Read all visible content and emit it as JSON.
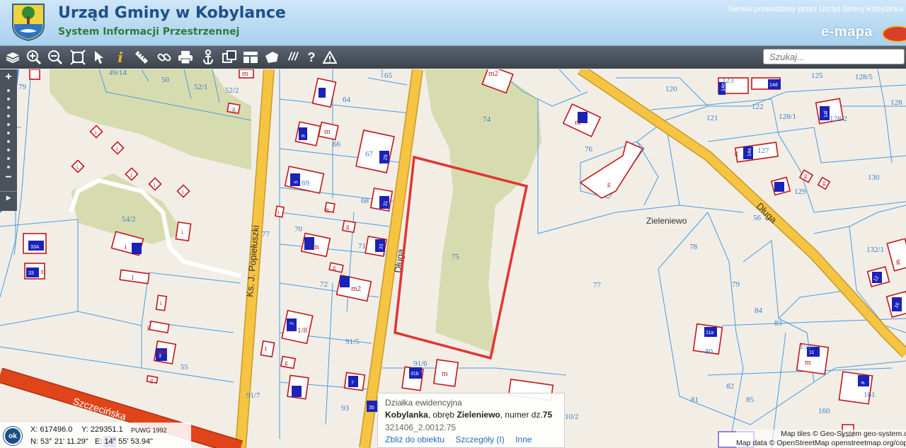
{
  "header": {
    "title": "Urząd Gminy w Kobylance",
    "subtitle": "System Informacji Przestrzennej",
    "service": "Serwis prowadzony przez Urząd Gminy Kobylanka",
    "brand": "e-mapa"
  },
  "toolbar": {
    "tools": [
      "layers-icon",
      "zoom-in-icon",
      "zoom-out-icon",
      "zoom-extent-icon",
      "pointer-icon",
      "info-icon",
      "measure-icon",
      "link-icon",
      "print-icon",
      "anchor-icon",
      "export-icon",
      "legend-icon",
      "shape-icon",
      "hatch-icon",
      "help-icon",
      "warning-icon"
    ],
    "search_placeholder": "Szukaj..."
  },
  "map": {
    "streets": [
      "Ks. J. Popiełuszki",
      "Długa",
      "Długa",
      "Szczecińska"
    ],
    "place": "Zieleniewo",
    "plots": [
      "49/14",
      "50",
      "52/1",
      "52/2",
      "54/2",
      "55",
      "64",
      "65",
      "66",
      "67",
      "68",
      "69",
      "70",
      "71",
      "72",
      "74",
      "75",
      "76",
      "77",
      "78",
      "79",
      "79",
      "80",
      "81",
      "82",
      "83",
      "84",
      "85",
      "91/5",
      "91/6",
      "91/7",
      "93",
      "120",
      "121",
      "122",
      "123",
      "125",
      "127",
      "128",
      "128/1",
      "128/2",
      "128/5",
      "129",
      "130",
      "132/1",
      "150",
      "160",
      "161"
    ],
    "building_labels": [
      "m2",
      "m",
      "g",
      "i",
      "t",
      "m2",
      "m",
      "g",
      "m",
      "i",
      "m",
      "m"
    ],
    "numbers": [
      "33A",
      "33",
      "14e",
      "14d",
      "14f",
      "14a",
      "12",
      "16",
      "11",
      "7",
      "3",
      "2",
      "9",
      "5",
      "31",
      "33"
    ]
  },
  "zoombar": {
    "plus": "+",
    "minus": "−",
    "toggle": "▸"
  },
  "popup": {
    "type": "Działka ewidencyjna",
    "place": "Kobylanka",
    "sep1": ", obręb ",
    "district": "Zieleniewo",
    "sep2": ", numer dz.",
    "parcel": "75",
    "id": "321406_2.0012.75",
    "link_zoom": "Zbliż do obiektu",
    "link_details": "Szczegóły (I)",
    "link_other": "Inne"
  },
  "coords": {
    "ok": "ok",
    "x": "X: 617496.0",
    "y": "Y: 229351.1",
    "system": "PUWG 1992",
    "n": "N: 53° 21' 11.29\"",
    "e": "E: 14° 55' 53.94\""
  },
  "attribution": {
    "line1": "Map tiles © Geo-System geo-system.com.pl",
    "line2": "Map data © OpenStreetMap openstreetmap.org/copyright"
  },
  "colors": {
    "road": "#f6c443",
    "plot_line": "#4a9be0",
    "building": "#c4151b",
    "selection": "#e03535",
    "green": "#d7dcb0"
  }
}
